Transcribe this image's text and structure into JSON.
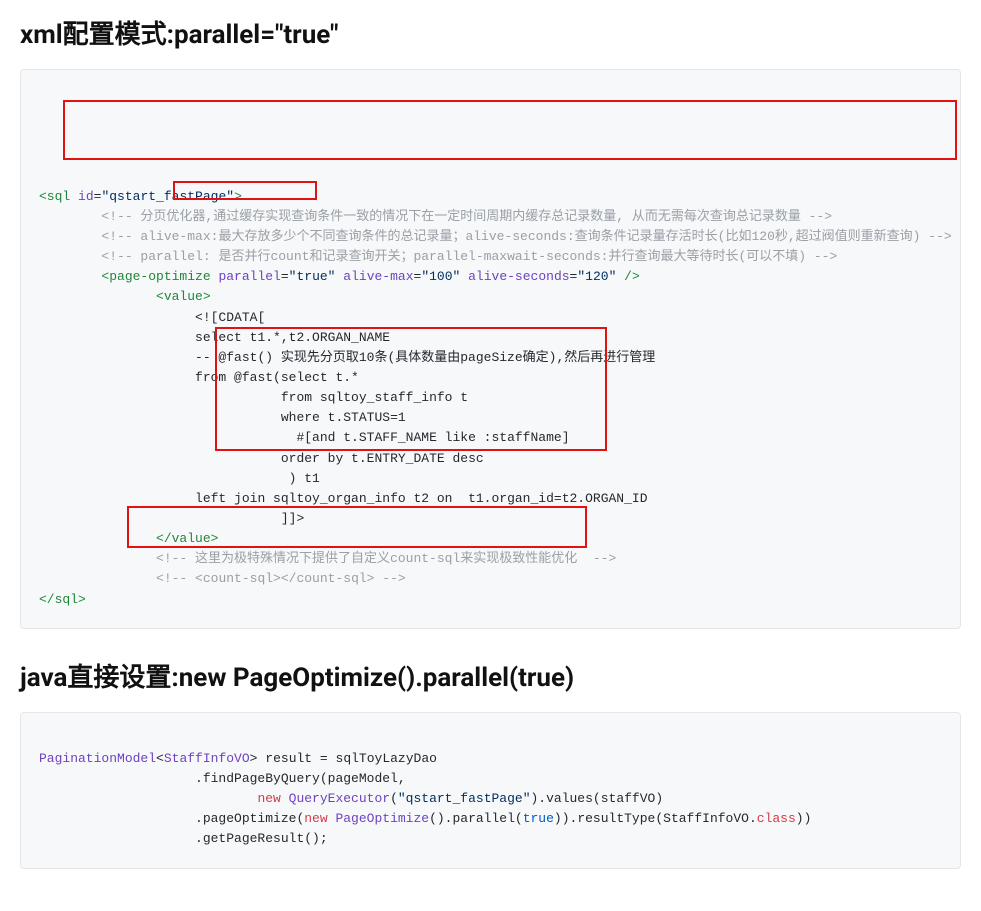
{
  "heading1": "xml配置模式:parallel=\"true\"",
  "heading2": "java直接设置:new PageOptimize().parallel(true)",
  "xml": {
    "l01_tag_open": "<sql",
    "l01_attr_id": " id",
    "l01_eq": "=",
    "l01_str": "\"qstart_fastPage\"",
    "l01_close": ">",
    "l02_comment": "<!-- 分页优化器,通过缓存实现查询条件一致的情况下在一定时间周期内缓存总记录数量, 从而无需每次查询总记录数量 -->",
    "l03_comment": "<!-- alive-max:最大存放多少个不同查询条件的总记录量；alive-seconds:查询条件记录量存活时长(比如120秒,超过阀值则重新查询) -->",
    "l04_comment": "<!-- parallel: 是否并行count和记录查询开关；parallel-maxwait-seconds:并行查询最大等待时长(可以不填) -->",
    "l05_tag": "<page-optimize",
    "l05_attr1": " parallel",
    "l05_str1": "\"true\"",
    "l05_attr2": " alive-max",
    "l05_str2": "\"100\"",
    "l05_attr3": " alive-seconds",
    "l05_str3": "\"120\"",
    "l05_close": " />",
    "l06_tag_open": "<value>",
    "l07": "<![CDATA[",
    "l08": "select t1.*,t2.ORGAN_NAME",
    "l09": "-- @fast() 实现先分页取10条(具体数量由pageSize确定),然后再进行管理",
    "l10": "from @fast(select t.*",
    "l11": "           from sqltoy_staff_info t",
    "l12": "           where t.STATUS=1",
    "l13": "             #[and t.STAFF_NAME like :staffName]",
    "l14": "           order by t.ENTRY_DATE desc",
    "l15": "            ) t1",
    "l16": "left join sqltoy_organ_info t2 on  t1.organ_id=t2.ORGAN_ID",
    "l17": "           ]]>",
    "l18_tag_close": "</value>",
    "l19_comment": "<!-- 这里为极特殊情况下提供了自定义count-sql来实现极致性能优化  -->",
    "l20_comment": "<!-- <count-sql></count-sql> -->",
    "l21_tag_close": "</sql>"
  },
  "java": {
    "l1_cls": "PaginationModel",
    "l1_generic_open": "<",
    "l1_type": "StaffInfoVO",
    "l1_generic_close": ">",
    "l1_var": " result ",
    "l1_eq": "=",
    "l1_dao": " sqlToyLazyDao",
    "l2": "                    .findPageByQuery(pageModel,",
    "l3_pad": "                            ",
    "l3_kw_new": "new",
    "l3_cls": " QueryExecutor",
    "l3_open": "(",
    "l3_str": "\"qstart_fastPage\"",
    "l3_close": ").values(staffVO)",
    "l4_pad": "                    .pageOptimize(",
    "l4_kw_new": "new",
    "l4_cls": " PageOptimize",
    "l4_mid": "().parallel(",
    "l4_bool": "true",
    "l4_after": ")).resultType(StaffInfoVO.",
    "l4_kw_class": "class",
    "l4_end": "))",
    "l5": "                    .getPageResult();"
  }
}
